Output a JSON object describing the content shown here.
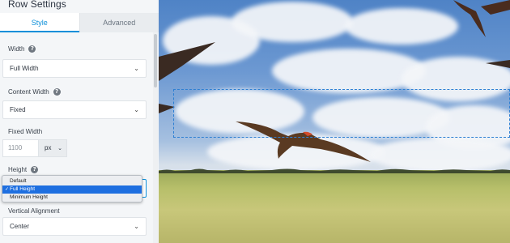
{
  "panel": {
    "title": "Row Settings",
    "tabs": [
      {
        "label": "Style",
        "active": true
      },
      {
        "label": "Advanced",
        "active": false
      }
    ]
  },
  "fields": {
    "width": {
      "label": "Width",
      "value": "Full Width"
    },
    "content_width": {
      "label": "Content Width",
      "value": "Fixed"
    },
    "fixed_width": {
      "label": "Fixed Width",
      "placeholder": "1100",
      "unit": "px"
    },
    "height": {
      "label": "Height",
      "options": [
        "Default",
        "Full Height",
        "Minimum Height"
      ],
      "selected": "Full Height"
    },
    "vertical_alignment": {
      "label": "Vertical Alignment",
      "value": "Center"
    }
  },
  "icons": {
    "help": "?",
    "chevron": "⌄",
    "check": "✓"
  },
  "colors": {
    "accent": "#0b8fd9",
    "selected_option": "#1e6fe0",
    "selection_outline": "#2d7fd3"
  }
}
